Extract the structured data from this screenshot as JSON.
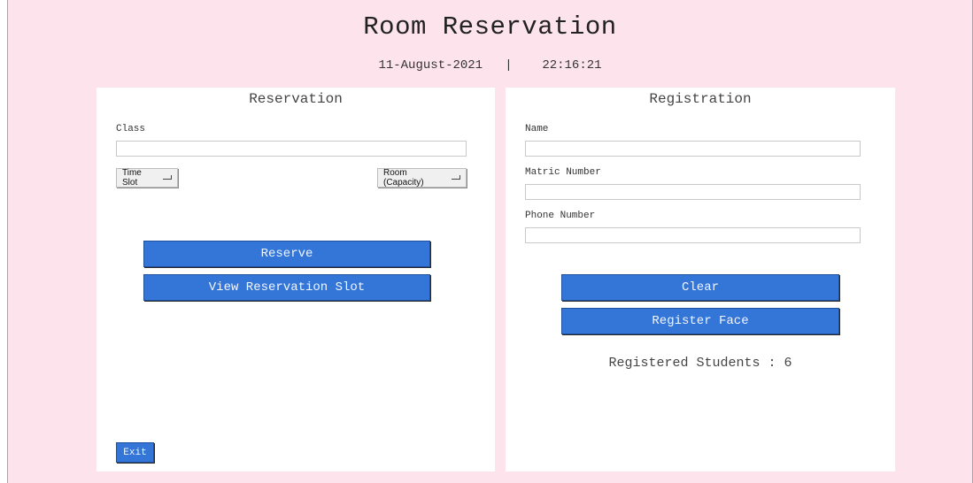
{
  "header": {
    "title": "Room Reservation",
    "date": "11-August-2021",
    "separator": "|",
    "time": "22:16:21"
  },
  "reservation": {
    "title": "Reservation",
    "class_label": "Class",
    "class_value": "",
    "time_slot_label": "Time Slot",
    "room_label": "Room (Capacity)",
    "reserve_label": "Reserve",
    "view_slot_label": "View Reservation Slot",
    "exit_label": "Exit"
  },
  "registration": {
    "title": "Registration",
    "name_label": "Name",
    "name_value": "",
    "matric_label": "Matric Number",
    "matric_value": "",
    "phone_label": "Phone Number",
    "phone_value": "",
    "clear_label": "Clear",
    "register_face_label": "Register Face",
    "registered_students": "Registered Students : 6"
  },
  "colors": {
    "window_bg": "#fde4ec",
    "panel_bg": "#ffffff",
    "button_blue": "#3476d8"
  }
}
